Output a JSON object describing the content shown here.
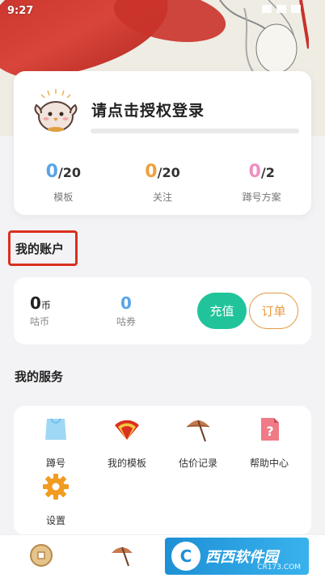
{
  "status_bar": {
    "time": "9:27"
  },
  "profile": {
    "login_prompt": "请点击授权登录",
    "progress_fraction": 0.0,
    "stats": [
      {
        "value": "0",
        "total": "/20",
        "label": "模板",
        "color": "#5aa4e8"
      },
      {
        "value": "0",
        "total": "/20",
        "label": "关注",
        "color": "#f0a03c"
      },
      {
        "value": "0",
        "total": "/2",
        "label": "蹲号方案",
        "color": "#ef8fc0"
      }
    ]
  },
  "account": {
    "section_title": "我的账户",
    "coin_value": "0",
    "coin_unit": "币",
    "coin_label": "咕币",
    "coupon_value": "0",
    "coupon_label": "咕券",
    "recharge_label": "充值",
    "order_label": "订单"
  },
  "services": {
    "section_title": "我的服务",
    "items": [
      {
        "label": "蹲号",
        "icon": "bag-icon"
      },
      {
        "label": "我的模板",
        "icon": "fan-icon"
      },
      {
        "label": "估价记录",
        "icon": "umbrella-icon"
      },
      {
        "label": "帮助中心",
        "icon": "help-doc-icon"
      },
      {
        "label": "设置",
        "icon": "gear-icon"
      }
    ]
  },
  "tabbar": {
    "tabs": [
      {
        "icon": "coin-icon"
      },
      {
        "icon": "umbrella-icon"
      }
    ]
  },
  "watermark": {
    "logo": "C",
    "text": "西西软件园",
    "sub": "CR173.COM"
  },
  "colors": {
    "accent_green": "#21c49a",
    "accent_orange": "#e49a40",
    "highlight_red": "#d9301f"
  }
}
